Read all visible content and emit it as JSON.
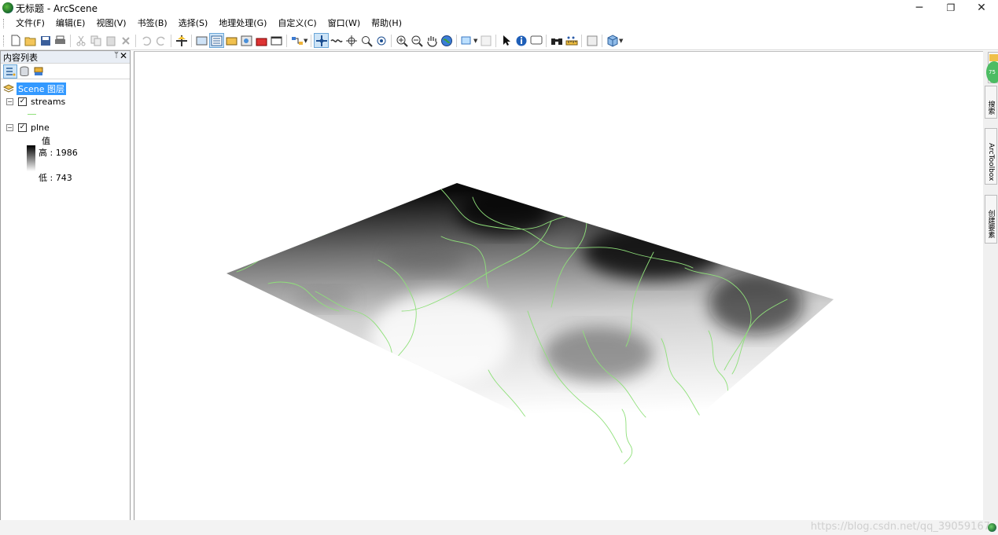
{
  "window": {
    "title": "无标题 - ArcScene",
    "minimize": "─",
    "restore": "❐",
    "close": "✕"
  },
  "menu": [
    "文件(F)",
    "编辑(E)",
    "视图(V)",
    "书签(B)",
    "选择(S)",
    "地理处理(G)",
    "自定义(C)",
    "窗口(W)",
    "帮助(H)"
  ],
  "toc": {
    "title": "内容列表",
    "pin": "ᛘ",
    "close": "✕",
    "scene_label": "Scene 图层",
    "layers": [
      {
        "name": "streams",
        "checked": true
      },
      {
        "name": "plne",
        "checked": true
      }
    ],
    "legend_title": "值",
    "high_label": "高 : 1986",
    "low_label": "低 : 743"
  },
  "right_tabs": [
    "搜索",
    "ArcToolbox",
    "创建要素"
  ],
  "badge": "75",
  "watermark": "https://blog.csdn.net/qq_39059167",
  "colors": {
    "stream": "#8fe07a",
    "selection": "#3399ff",
    "dem_high": "#000000",
    "dem_low": "#ffffff"
  }
}
